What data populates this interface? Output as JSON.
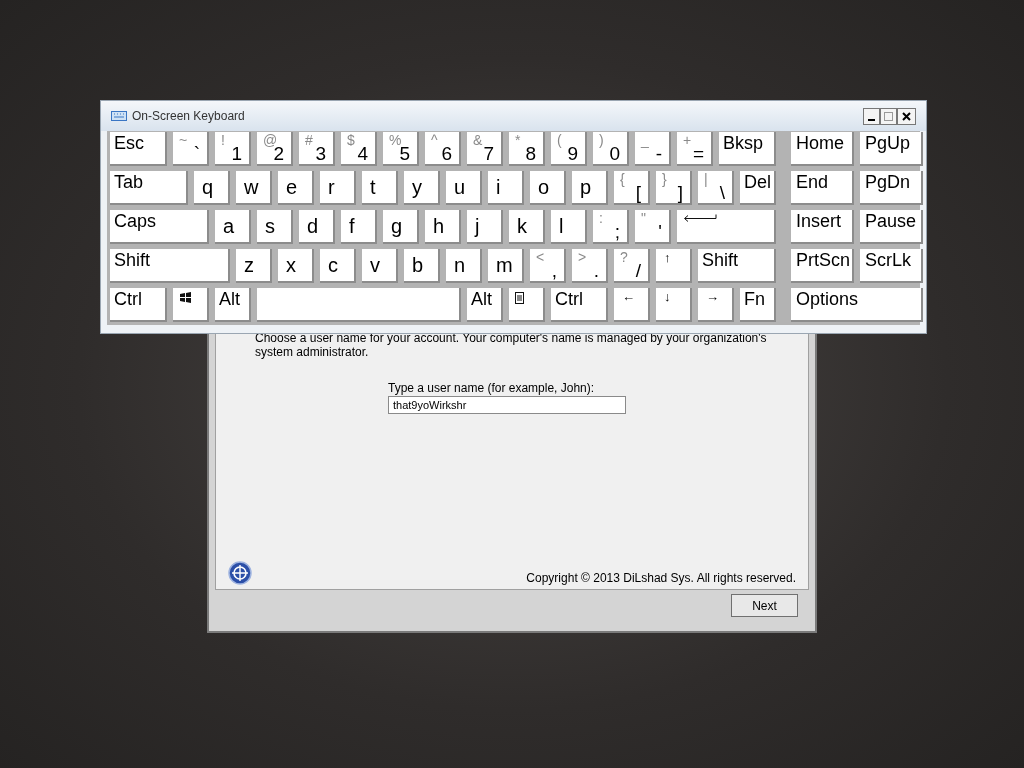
{
  "setup_dialog": {
    "description": "Choose a user name for your account.  Your computer's name is managed by your organization's system administrator.",
    "field_label": "Type a user name (for example, John):",
    "user_name": "that9yoWirkshr",
    "copyright": "Copyright © 2013 DiLshad Sys.  All rights reserved.",
    "next_button": "Next"
  },
  "keyboard": {
    "title": "On-Screen Keyboard",
    "rows": [
      {
        "keys": [
          {
            "kind": "word",
            "label": "Esc"
          },
          {
            "kind": "dual",
            "shift": "~",
            "label": "`"
          },
          {
            "kind": "dual",
            "shift": "!",
            "label": "1"
          },
          {
            "kind": "dual",
            "shift": "@",
            "label": "2"
          },
          {
            "kind": "dual",
            "shift": "#",
            "label": "3"
          },
          {
            "kind": "dual",
            "shift": "$",
            "label": "4"
          },
          {
            "kind": "dual",
            "shift": "%",
            "label": "5"
          },
          {
            "kind": "dual",
            "shift": "^",
            "label": "6"
          },
          {
            "kind": "dual",
            "shift": "&",
            "label": "7"
          },
          {
            "kind": "dual",
            "shift": "*",
            "label": "8"
          },
          {
            "kind": "dual",
            "shift": "(",
            "label": "9"
          },
          {
            "kind": "dual",
            "shift": ")",
            "label": "0"
          },
          {
            "kind": "dual",
            "shift": "_",
            "label": "-"
          },
          {
            "kind": "dual",
            "shift": "+",
            "label": "="
          },
          {
            "kind": "word",
            "label": "Bksp"
          }
        ],
        "nav": [
          "Home",
          "PgUp"
        ]
      },
      {
        "keys": [
          {
            "kind": "word",
            "label": "Tab"
          },
          {
            "kind": "letter",
            "label": "q"
          },
          {
            "kind": "letter",
            "label": "w"
          },
          {
            "kind": "letter",
            "label": "e"
          },
          {
            "kind": "letter",
            "label": "r"
          },
          {
            "kind": "letter",
            "label": "t"
          },
          {
            "kind": "letter",
            "label": "y"
          },
          {
            "kind": "letter",
            "label": "u"
          },
          {
            "kind": "letter",
            "label": "i"
          },
          {
            "kind": "letter",
            "label": "o"
          },
          {
            "kind": "letter",
            "label": "p"
          },
          {
            "kind": "dual",
            "shift": "{",
            "label": "["
          },
          {
            "kind": "dual",
            "shift": "}",
            "label": "]"
          },
          {
            "kind": "dual",
            "shift": "|",
            "label": "\\"
          },
          {
            "kind": "word",
            "label": "Del"
          }
        ],
        "nav": [
          "End",
          "PgDn"
        ]
      },
      {
        "keys": [
          {
            "kind": "word",
            "label": "Caps"
          },
          {
            "kind": "letter",
            "label": "a"
          },
          {
            "kind": "letter",
            "label": "s"
          },
          {
            "kind": "letter",
            "label": "d"
          },
          {
            "kind": "letter",
            "label": "f"
          },
          {
            "kind": "letter",
            "label": "g"
          },
          {
            "kind": "letter",
            "label": "h"
          },
          {
            "kind": "letter",
            "label": "j"
          },
          {
            "kind": "letter",
            "label": "k"
          },
          {
            "kind": "letter",
            "label": "l"
          },
          {
            "kind": "dual",
            "shift": ":",
            "label": ";"
          },
          {
            "kind": "dual",
            "shift": "\"",
            "label": "'"
          },
          {
            "kind": "enter"
          }
        ],
        "nav": [
          "Insert",
          "Pause"
        ]
      },
      {
        "keys": [
          {
            "kind": "word",
            "label": "Shift"
          },
          {
            "kind": "letter",
            "label": "z"
          },
          {
            "kind": "letter",
            "label": "x"
          },
          {
            "kind": "letter",
            "label": "c"
          },
          {
            "kind": "letter",
            "label": "v"
          },
          {
            "kind": "letter",
            "label": "b"
          },
          {
            "kind": "letter",
            "label": "n"
          },
          {
            "kind": "letter",
            "label": "m"
          },
          {
            "kind": "dual",
            "shift": "<",
            "label": ","
          },
          {
            "kind": "dual",
            "shift": ">",
            "label": "."
          },
          {
            "kind": "dual",
            "shift": "?",
            "label": "/"
          },
          {
            "kind": "arrow",
            "label": "↑"
          },
          {
            "kind": "word",
            "label": "Shift"
          }
        ],
        "nav": [
          "PrtScn",
          "ScrLk"
        ]
      },
      {
        "keys": [
          {
            "kind": "word",
            "label": "Ctrl"
          },
          {
            "kind": "windows"
          },
          {
            "kind": "word",
            "label": "Alt"
          },
          {
            "kind": "space"
          },
          {
            "kind": "word",
            "label": "Alt"
          },
          {
            "kind": "menu"
          },
          {
            "kind": "word",
            "label": "Ctrl"
          },
          {
            "kind": "arrow",
            "label": "←"
          },
          {
            "kind": "arrow",
            "label": "↓"
          },
          {
            "kind": "arrow",
            "label": "→"
          },
          {
            "kind": "word",
            "label": "Fn"
          }
        ],
        "nav": [
          "Options"
        ]
      }
    ]
  }
}
